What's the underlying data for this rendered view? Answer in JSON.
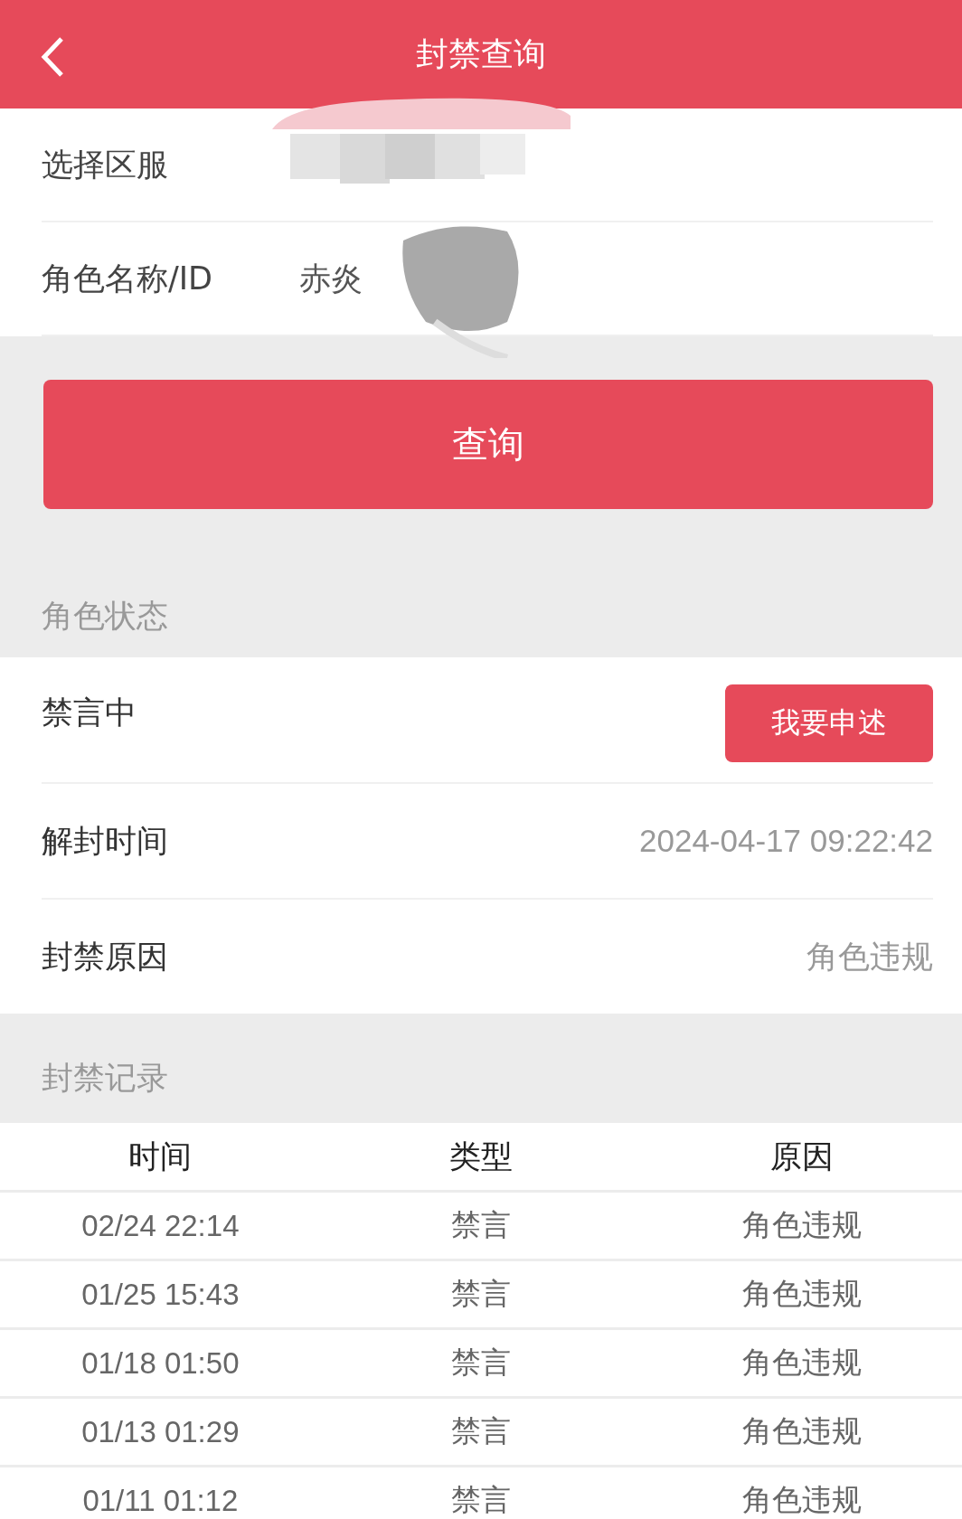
{
  "header": {
    "title": "封禁查询"
  },
  "form": {
    "fields": [
      {
        "label": "选择区服",
        "redacted": true
      },
      {
        "label": "角色名称/ID",
        "value": "赤炎",
        "redacted": true
      }
    ]
  },
  "query_button": "查询",
  "status_section": {
    "title": "角色状态",
    "status": "禁言中",
    "appeal_button": "我要申述",
    "details": [
      {
        "label": "解封时间",
        "value": "2024-04-17 09:22:42"
      },
      {
        "label": "封禁原因",
        "value": "角色违规"
      }
    ]
  },
  "records_section": {
    "title": "封禁记录",
    "table": {
      "columns": [
        "时间",
        "类型",
        "原因"
      ],
      "rows": [
        [
          "02/24 22:14",
          "禁言",
          "角色违规"
        ],
        [
          "01/25 15:43",
          "禁言",
          "角色违规"
        ],
        [
          "01/18 01:50",
          "禁言",
          "角色违规"
        ],
        [
          "01/13 01:29",
          "禁言",
          "角色违规"
        ],
        [
          "01/11 01:12",
          "禁言",
          "角色违规"
        ]
      ]
    }
  }
}
